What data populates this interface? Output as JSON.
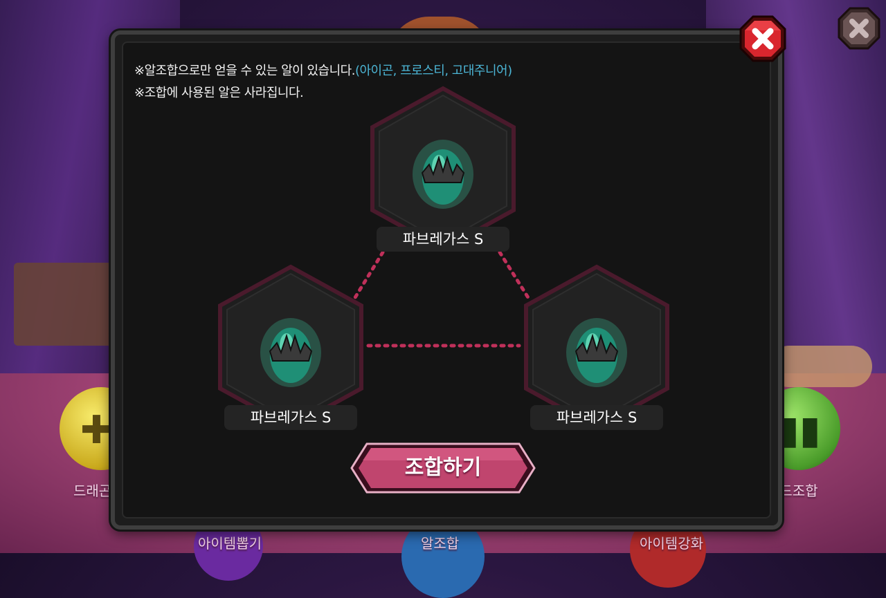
{
  "notices": {
    "line1_main": "※알조합으로만 얻을 수 있는 알이 있습니다.",
    "line1_accent": "(아이곤, 프로스티, 고대주니어)",
    "line2": "※조합에 사용된 알은 사라집니다."
  },
  "slots": [
    {
      "name": "파브레가스 S"
    },
    {
      "name": "파브레가스 S"
    },
    {
      "name": "파브레가스 S"
    }
  ],
  "combine_button": {
    "label": "조합하기"
  },
  "background_menu": {
    "left_label": "드래곤",
    "right_label": "카드조합",
    "bottom_labels": [
      "아이템뽑기",
      "알조합",
      "아이템강화"
    ]
  },
  "colors": {
    "accent": "#4cb6d6",
    "button": "#c0456e",
    "close": "#d9262e",
    "egg_glow": "#3fe0b0"
  },
  "icons": {
    "close": "close-x-icon",
    "egg": "dragon-egg-icon"
  }
}
